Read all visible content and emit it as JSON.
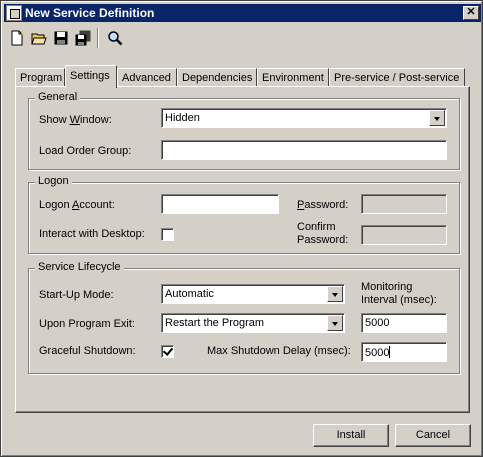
{
  "window": {
    "title": "New Service Definition",
    "close_glyph": "✕"
  },
  "toolbar": {
    "buttons": [
      {
        "icon": "new-file-icon"
      },
      {
        "icon": "open-folder-icon"
      },
      {
        "icon": "save-icon"
      },
      {
        "icon": "save-all-icon"
      },
      {
        "icon": "search-icon"
      }
    ]
  },
  "tabs": [
    {
      "label": "Program",
      "active": false
    },
    {
      "label": "Settings",
      "active": true
    },
    {
      "label": "Advanced",
      "active": false
    },
    {
      "label": "Dependencies",
      "active": false
    },
    {
      "label": "Environment",
      "active": false
    },
    {
      "label": "Pre-service / Post-service",
      "active": false
    }
  ],
  "general": {
    "title": "General",
    "show_window_label_pre": "Show ",
    "show_window_label_u": "W",
    "show_window_label_post": "indow:",
    "show_window_value": "Hidden",
    "load_order_label": "Load Order Group:",
    "load_order_value": ""
  },
  "logon": {
    "title": "Logon",
    "account_label_pre": "Logon ",
    "account_label_u": "A",
    "account_label_post": "ccount:",
    "account_value": "",
    "password_label_pre": "",
    "password_label_u": "P",
    "password_label_post": "assword:",
    "interact_label": "Interact with Desktop:",
    "interact_checked": false,
    "confirm_label_line1": "Confirm",
    "confirm_label_line2": "Password:"
  },
  "lifecycle": {
    "title": "Service Lifecycle",
    "startup_label": "Start-Up Mode:",
    "startup_value": "Automatic",
    "monitoring_label_line1": "Monitoring",
    "monitoring_label_line2": "Interval (msec):",
    "exit_label": "Upon Program Exit:",
    "exit_value": "Restart the Program",
    "monitoring_value": "5000",
    "graceful_label": "Graceful Shutdown:",
    "graceful_checked": true,
    "max_delay_label": "Max Shutdown Delay (msec):",
    "max_delay_value": "5000"
  },
  "buttons": {
    "install": "Install",
    "cancel": "Cancel"
  }
}
